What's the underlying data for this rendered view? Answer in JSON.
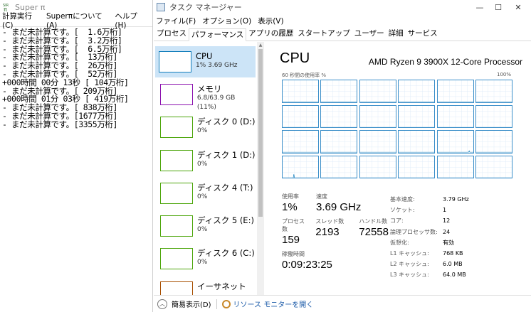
{
  "superpi": {
    "title": "Super π",
    "menu": [
      "計算実行(C)",
      "Superπについて(A)",
      "ヘルプ(H)"
    ],
    "output": [
      "- まだ未計算です。[  1.6万桁]",
      "- まだ未計算です。[  3.2万桁]",
      "- まだ未計算です。[  6.5万桁]",
      "- まだ未計算です。[  13万桁]",
      "- まだ未計算です。[  26万桁]",
      "- まだ未計算です。[  52万桁]",
      "+000時間 00分 13秒 [ 104万桁]",
      "- まだ未計算です。[ 209万桁]",
      "+000時間 01分 03秒 [ 419万桁]",
      "- まだ未計算です。[ 838万桁]",
      "- まだ未計算です。[1677万桁]",
      "- まだ未計算です。[3355万桁]"
    ]
  },
  "taskmgr": {
    "title": "タスク マネージャー",
    "window_controls": [
      "—",
      "☐",
      "✕"
    ],
    "menu": [
      "ファイル(F)",
      "オプション(O)",
      "表示(V)"
    ],
    "tabs": [
      {
        "label": "プロセス",
        "active": false
      },
      {
        "label": "パフォーマンス",
        "active": true
      },
      {
        "label": "アプリの履歴",
        "active": false
      },
      {
        "label": "スタートアップ",
        "active": false
      },
      {
        "label": "ユーザー",
        "active": false
      },
      {
        "label": "詳細",
        "active": false
      },
      {
        "label": "サービス",
        "active": false
      }
    ],
    "resources": [
      {
        "name": "CPU",
        "sub": "1%  3.69 GHz",
        "color": "#117dbb",
        "selected": true
      },
      {
        "name": "メモリ",
        "sub": "6.8/63.9 GB (11%)",
        "color": "#8b12ae",
        "selected": false
      },
      {
        "name": "ディスク 0 (D:)",
        "sub": "0%",
        "color": "#4da60c",
        "selected": false
      },
      {
        "name": "ディスク 1 (D:)",
        "sub": "0%",
        "color": "#4da60c",
        "selected": false
      },
      {
        "name": "ディスク 4 (T:)",
        "sub": "0%",
        "color": "#4da60c",
        "selected": false
      },
      {
        "name": "ディスク 5 (E:)",
        "sub": "0%",
        "color": "#4da60c",
        "selected": false
      },
      {
        "name": "ディスク 6 (C:)",
        "sub": "0%",
        "color": "#4da60c",
        "selected": false
      },
      {
        "name": "イーサネット",
        "sub": "",
        "color": "#a74f01",
        "selected": false
      }
    ],
    "cpu": {
      "title": "CPU",
      "model": "AMD Ryzen 9 3900X 12-Core Processor",
      "graph_caption_left": "60 秒間の使用率 %",
      "graph_caption_right": "100%",
      "graph_color": "#117dbb",
      "core_count": 24,
      "stats": {
        "usage_label": "使用率",
        "usage_value": "1%",
        "speed_label": "速度",
        "speed_value": "3.69 GHz",
        "processes_label": "プロセス数",
        "processes_value": "159",
        "threads_label": "スレッド数",
        "threads_value": "2193",
        "handles_label": "ハンドル数",
        "handles_value": "72558",
        "uptime_label": "稼働時間",
        "uptime_value": "0:09:23:25"
      },
      "info": [
        {
          "k": "基本速度:",
          "v": "3.79 GHz"
        },
        {
          "k": "ソケット:",
          "v": "1"
        },
        {
          "k": "コア:",
          "v": "12"
        },
        {
          "k": "論理プロセッサ数:",
          "v": "24"
        },
        {
          "k": "仮想化:",
          "v": "有効"
        },
        {
          "k": "L1 キャッシュ:",
          "v": "768 KB"
        },
        {
          "k": "L2 キャッシュ:",
          "v": "6.0 MB"
        },
        {
          "k": "L3 キャッシュ:",
          "v": "64.0 MB"
        }
      ]
    },
    "footer": {
      "fewer_details": "簡易表示(D)",
      "resmon_link": "リソース モニターを開く"
    }
  }
}
